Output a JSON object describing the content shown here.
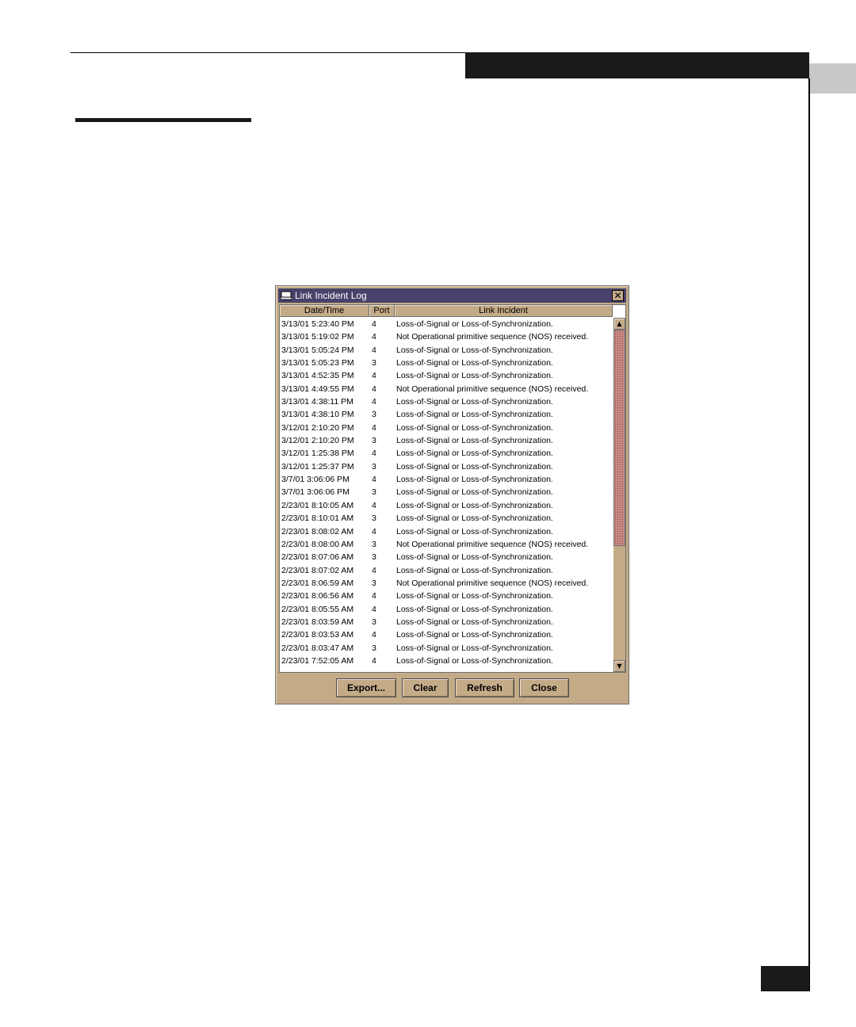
{
  "dialog": {
    "title": "Link Incident Log",
    "columns": [
      "Date/Time",
      "Port",
      "Link Incident"
    ],
    "buttons": {
      "export": "Export...",
      "clear": "Clear",
      "refresh": "Refresh",
      "close": "Close"
    },
    "icons": {
      "title": "window-icon",
      "close": "close-icon",
      "scroll_up": "arrow-up-icon",
      "scroll_down": "arrow-down-icon"
    },
    "rows": [
      {
        "datetime": "3/13/01 5:23:40 PM",
        "port": "4",
        "incident": "Loss-of-Signal or Loss-of-Synchronization."
      },
      {
        "datetime": "3/13/01 5:19:02 PM",
        "port": "4",
        "incident": "Not Operational primitive sequence (NOS) received."
      },
      {
        "datetime": "3/13/01 5:05:24 PM",
        "port": "4",
        "incident": "Loss-of-Signal or Loss-of-Synchronization."
      },
      {
        "datetime": "3/13/01 5:05:23 PM",
        "port": "3",
        "incident": "Loss-of-Signal or Loss-of-Synchronization."
      },
      {
        "datetime": "3/13/01 4:52:35 PM",
        "port": "4",
        "incident": "Loss-of-Signal or Loss-of-Synchronization."
      },
      {
        "datetime": "3/13/01 4:49:55 PM",
        "port": "4",
        "incident": "Not Operational primitive sequence (NOS) received."
      },
      {
        "datetime": "3/13/01 4:38:11 PM",
        "port": "4",
        "incident": "Loss-of-Signal or Loss-of-Synchronization."
      },
      {
        "datetime": "3/13/01 4:38:10 PM",
        "port": "3",
        "incident": "Loss-of-Signal or Loss-of-Synchronization."
      },
      {
        "datetime": "3/12/01 2:10:20 PM",
        "port": "4",
        "incident": "Loss-of-Signal or Loss-of-Synchronization."
      },
      {
        "datetime": "3/12/01 2:10:20 PM",
        "port": "3",
        "incident": "Loss-of-Signal or Loss-of-Synchronization."
      },
      {
        "datetime": "3/12/01 1:25:38 PM",
        "port": "4",
        "incident": "Loss-of-Signal or Loss-of-Synchronization."
      },
      {
        "datetime": "3/12/01 1:25:37 PM",
        "port": "3",
        "incident": "Loss-of-Signal or Loss-of-Synchronization."
      },
      {
        "datetime": "3/7/01 3:06:06 PM",
        "port": "4",
        "incident": "Loss-of-Signal or Loss-of-Synchronization."
      },
      {
        "datetime": "3/7/01 3:06:06 PM",
        "port": "3",
        "incident": "Loss-of-Signal or Loss-of-Synchronization."
      },
      {
        "datetime": "2/23/01 8:10:05 AM",
        "port": "4",
        "incident": "Loss-of-Signal or Loss-of-Synchronization."
      },
      {
        "datetime": "2/23/01 8:10:01 AM",
        "port": "3",
        "incident": "Loss-of-Signal or Loss-of-Synchronization."
      },
      {
        "datetime": "2/23/01 8:08:02 AM",
        "port": "4",
        "incident": "Loss-of-Signal or Loss-of-Synchronization."
      },
      {
        "datetime": "2/23/01 8:08:00 AM",
        "port": "3",
        "incident": "Not Operational primitive sequence (NOS) received."
      },
      {
        "datetime": "2/23/01 8:07:06 AM",
        "port": "3",
        "incident": "Loss-of-Signal or Loss-of-Synchronization."
      },
      {
        "datetime": "2/23/01 8:07:02 AM",
        "port": "4",
        "incident": "Loss-of-Signal or Loss-of-Synchronization."
      },
      {
        "datetime": "2/23/01 8:06:59 AM",
        "port": "3",
        "incident": "Not Operational primitive sequence (NOS) received."
      },
      {
        "datetime": "2/23/01 8:06:56 AM",
        "port": "4",
        "incident": "Loss-of-Signal or Loss-of-Synchronization."
      },
      {
        "datetime": "2/23/01 8:05:55 AM",
        "port": "4",
        "incident": "Loss-of-Signal or Loss-of-Synchronization."
      },
      {
        "datetime": "2/23/01 8:03:59 AM",
        "port": "3",
        "incident": "Loss-of-Signal or Loss-of-Synchronization."
      },
      {
        "datetime": "2/23/01 8:03:53 AM",
        "port": "4",
        "incident": "Loss-of-Signal or Loss-of-Synchronization."
      },
      {
        "datetime": "2/23/01 8:03:47 AM",
        "port": "3",
        "incident": "Loss-of-Signal or Loss-of-Synchronization."
      },
      {
        "datetime": "2/23/01 7:52:05 AM",
        "port": "4",
        "incident": "Loss-of-Signal or Loss-of-Synchronization."
      }
    ]
  },
  "colors": {
    "dialog_bg": "#c4ab88",
    "titlebar_bg": "#48426a",
    "scroll_thumb": "#c98a84",
    "page_bars": "#1a1a1a"
  }
}
